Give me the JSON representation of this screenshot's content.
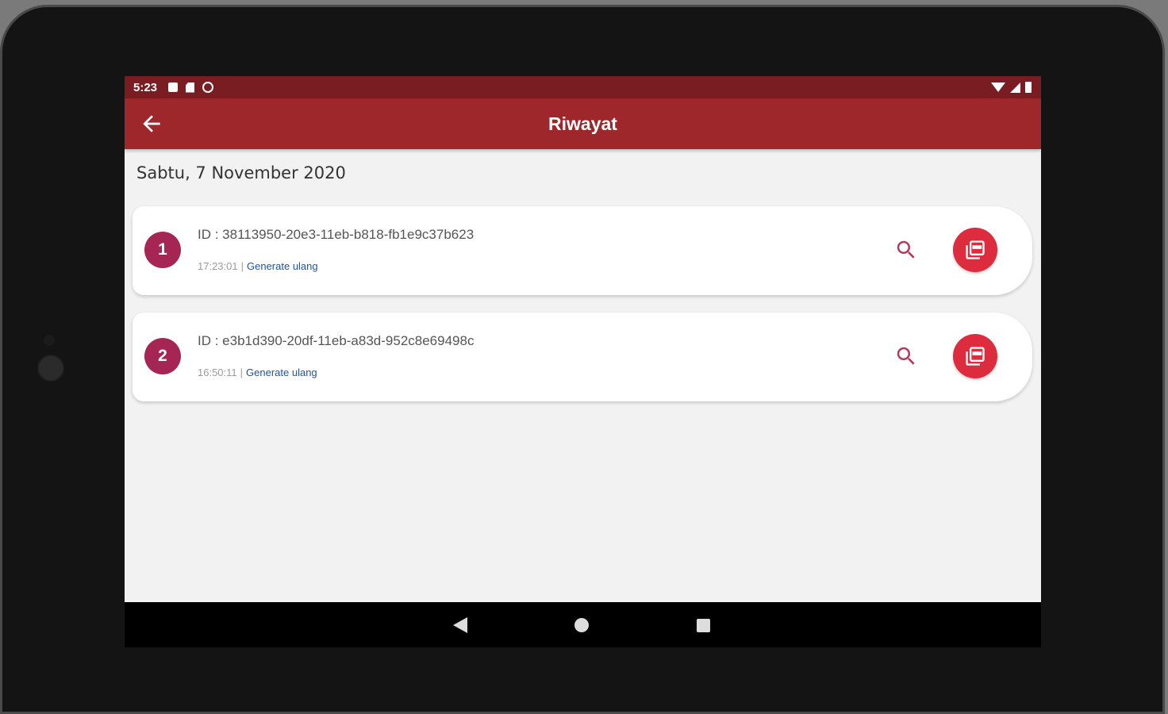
{
  "status_bar": {
    "time": "5:23"
  },
  "app_bar": {
    "title": "Riwayat"
  },
  "date_heading": "Sabtu, 7 November 2020",
  "items": [
    {
      "number": "1",
      "id": "ID : 38113950-20e3-11eb-b818-fb1e9c37b623",
      "time": "17:23:01",
      "separator": "|",
      "action": "Generate ulang"
    },
    {
      "number": "2",
      "id": "ID : e3b1d390-20df-11eb-a83d-952c8e69498c",
      "time": "16:50:11",
      "separator": "|",
      "action": "Generate ulang"
    }
  ],
  "colors": {
    "status_bar": "#7a1d22",
    "app_bar": "#9e272c",
    "number_badge": "#a52653",
    "pdf_button": "#de2c3f",
    "link": "#1a55a8"
  },
  "icons": {
    "back": "arrow-left-icon",
    "search": "search-icon",
    "pdf": "pdf-file-icon"
  }
}
